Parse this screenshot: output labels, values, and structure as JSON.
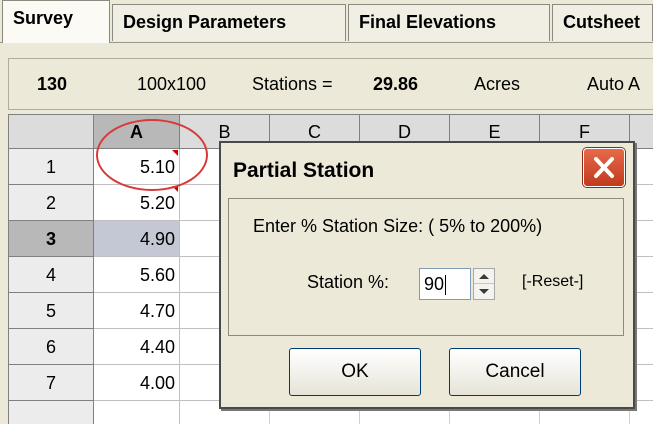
{
  "tabs": [
    {
      "label": "Survey"
    },
    {
      "label": "Design Parameters"
    },
    {
      "label": "Final Elevations"
    },
    {
      "label": "Cutsheet"
    }
  ],
  "infobar": {
    "count": "130",
    "grid_size": "100x100",
    "stations_label": "Stations =",
    "stations_value": "29.86",
    "acres_label": "Acres",
    "auto_label": "Auto A"
  },
  "grid": {
    "columns": [
      "A",
      "B",
      "C",
      "D",
      "E",
      "F"
    ],
    "rows": [
      {
        "num": "1",
        "a": "5.10"
      },
      {
        "num": "2",
        "a": "5.20"
      },
      {
        "num": "3",
        "a": "4.90"
      },
      {
        "num": "4",
        "a": "5.60"
      },
      {
        "num": "5",
        "a": "4.70"
      },
      {
        "num": "6",
        "a": "4.40"
      },
      {
        "num": "7",
        "a": "4.00"
      }
    ]
  },
  "dialog": {
    "title": "Partial Station",
    "prompt": "Enter %  Station Size: ( 5%  to  200%)",
    "field_label": "Station %:",
    "field_value": "90",
    "reset_label": "[-Reset-]",
    "ok_label": "OK",
    "cancel_label": "Cancel"
  },
  "colors": {
    "highlight_circle": "#d83a3a",
    "close_button": "#c23a1e",
    "selected_cell": "#c4c8d4"
  }
}
